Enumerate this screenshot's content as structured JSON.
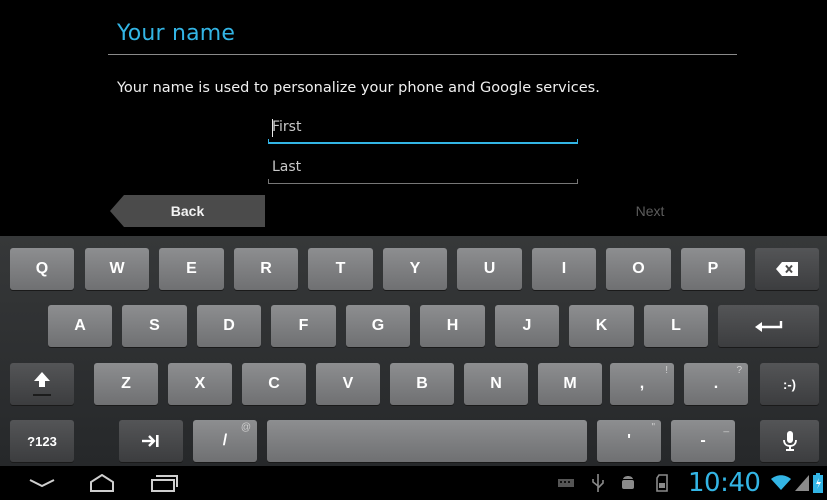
{
  "form": {
    "title": "Your name",
    "subtitle": "Your name is used to personalize your phone and Google services.",
    "first_placeholder": "First",
    "last_placeholder": "Last",
    "back_label": "Back",
    "next_label": "Next"
  },
  "keyboard": {
    "row1": [
      "Q",
      "W",
      "E",
      "R",
      "T",
      "Y",
      "U",
      "I",
      "O",
      "P"
    ],
    "row2": [
      "A",
      "S",
      "D",
      "F",
      "G",
      "H",
      "J",
      "K",
      "L"
    ],
    "row3": [
      "Z",
      "X",
      "C",
      "V",
      "B",
      "N",
      "M"
    ],
    "comma": ",",
    "comma_hint": "!",
    "period": ".",
    "period_hint": "?",
    "smiley": ":-)",
    "symbols": "?123",
    "slash": "/",
    "slash_hint": "@",
    "apostrophe": "'",
    "apostrophe_hint": "\"",
    "dash": "-",
    "dash_hint": "_"
  },
  "status": {
    "time": "10:40",
    "accent_color": "#33b5e5"
  }
}
